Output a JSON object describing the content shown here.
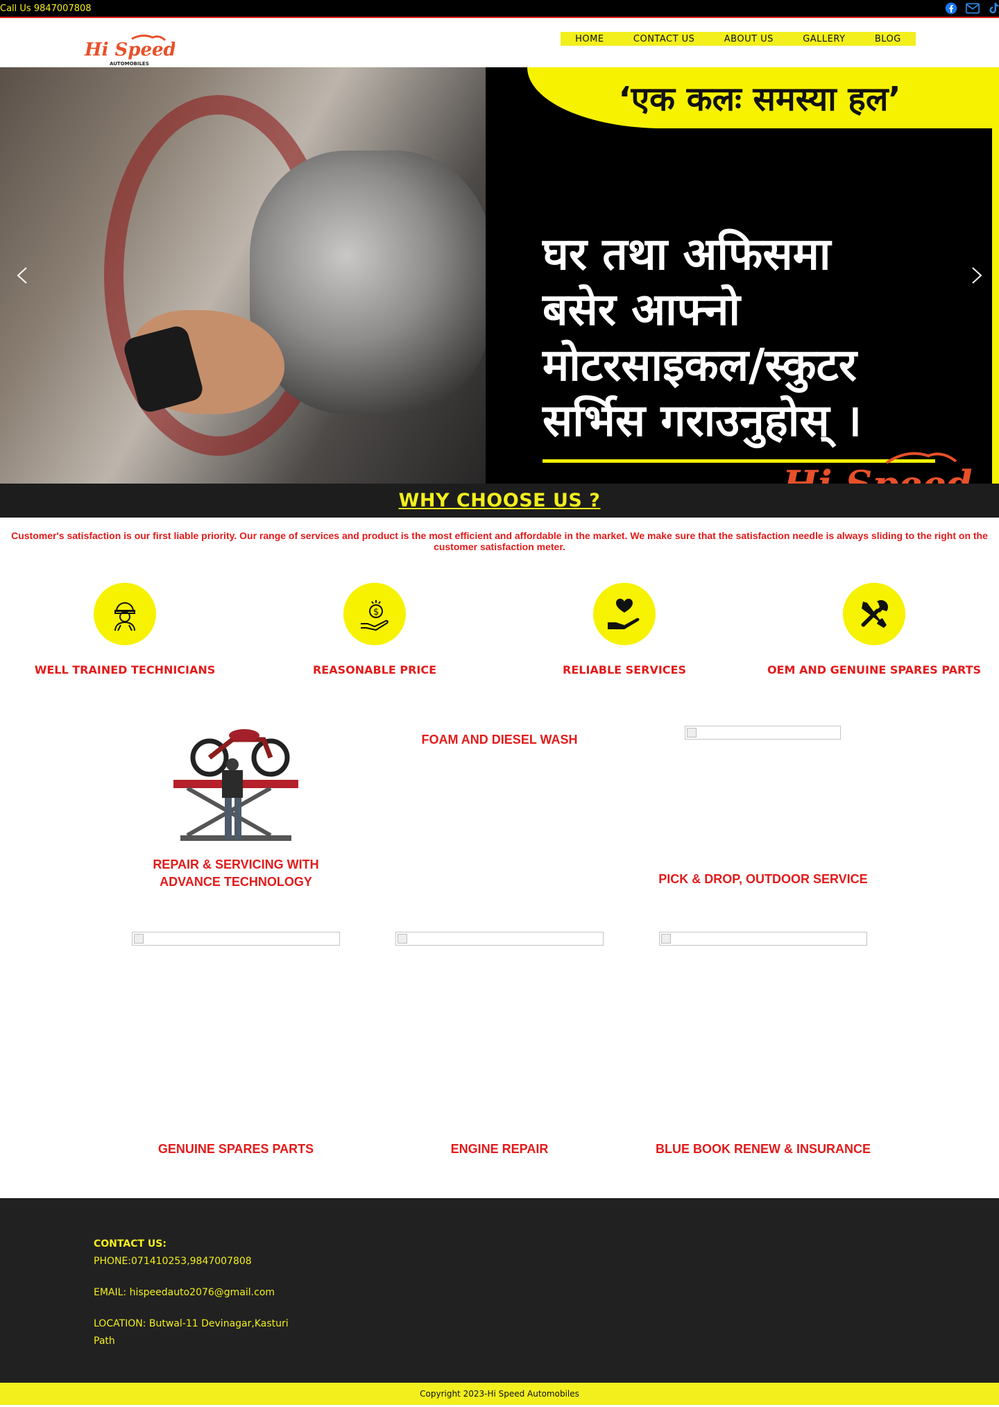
{
  "topbar": {
    "call": "Call Us 9847007808",
    "socials": [
      "facebook-icon",
      "email-icon",
      "tiktok-icon"
    ]
  },
  "header": {
    "logo_text": "Hi Speed",
    "logo_sub": "AUTOMOBILES",
    "nav": [
      "HOME",
      "CONTACT US",
      "ABOUT US",
      "GALLERY",
      "BLOG"
    ]
  },
  "hero": {
    "banner": "‘एक कलः समस्या हल’",
    "lines": [
      "घर तथा अफिसमा",
      "बसेर आफ्नो",
      "मोटरसाइकल/स्कुटर",
      "सर्भिस गराउनुहोस् ।"
    ],
    "brand": "Hi Speed"
  },
  "why": {
    "title": "WHY CHOOSE US ?",
    "tagline": "Customer's satisfaction is our first liable priority. Our range of services and product is the most efficient and affordable in the market. We make sure that the satisfaction needle is always sliding to the right on the customer satisfaction meter.",
    "features": [
      {
        "label": "WELL TRAINED TECHNICIANS",
        "icon": "technician-icon"
      },
      {
        "label": "REASONABLE PRICE",
        "icon": "price-hand-icon"
      },
      {
        "label": "RELIABLE SERVICES",
        "icon": "heart-hand-icon"
      },
      {
        "label": "OEM AND GENUINE SPARES PARTS",
        "icon": "tools-icon"
      }
    ]
  },
  "services": [
    {
      "label": "REPAIR & SERVICING WITH ADVANCE TECHNOLOGY"
    },
    {
      "label": "FOAM AND DIESEL WASH"
    },
    {
      "label": "PICK & DROP, OUTDOOR SERVICE"
    },
    {
      "label": "GENUINE SPARES PARTS"
    },
    {
      "label": "ENGINE REPAIR"
    },
    {
      "label": "BLUE BOOK RENEW & INSURANCE"
    }
  ],
  "footer": {
    "contact_heading": "CONTACT US:",
    "phone": "PHONE:071410253,9847007808",
    "email": "EMAIL: hispeedauto2076@gmail.com",
    "location_1": "LOCATION: Butwal-11 Devinagar,Kasturi",
    "location_2": "Path",
    "copyright": "Copyright 2023-Hi Speed Automobiles"
  },
  "colors": {
    "accent_yellow": "#f2ef1d",
    "accent_red": "#e31b1b",
    "dark": "#1d1d1d"
  }
}
